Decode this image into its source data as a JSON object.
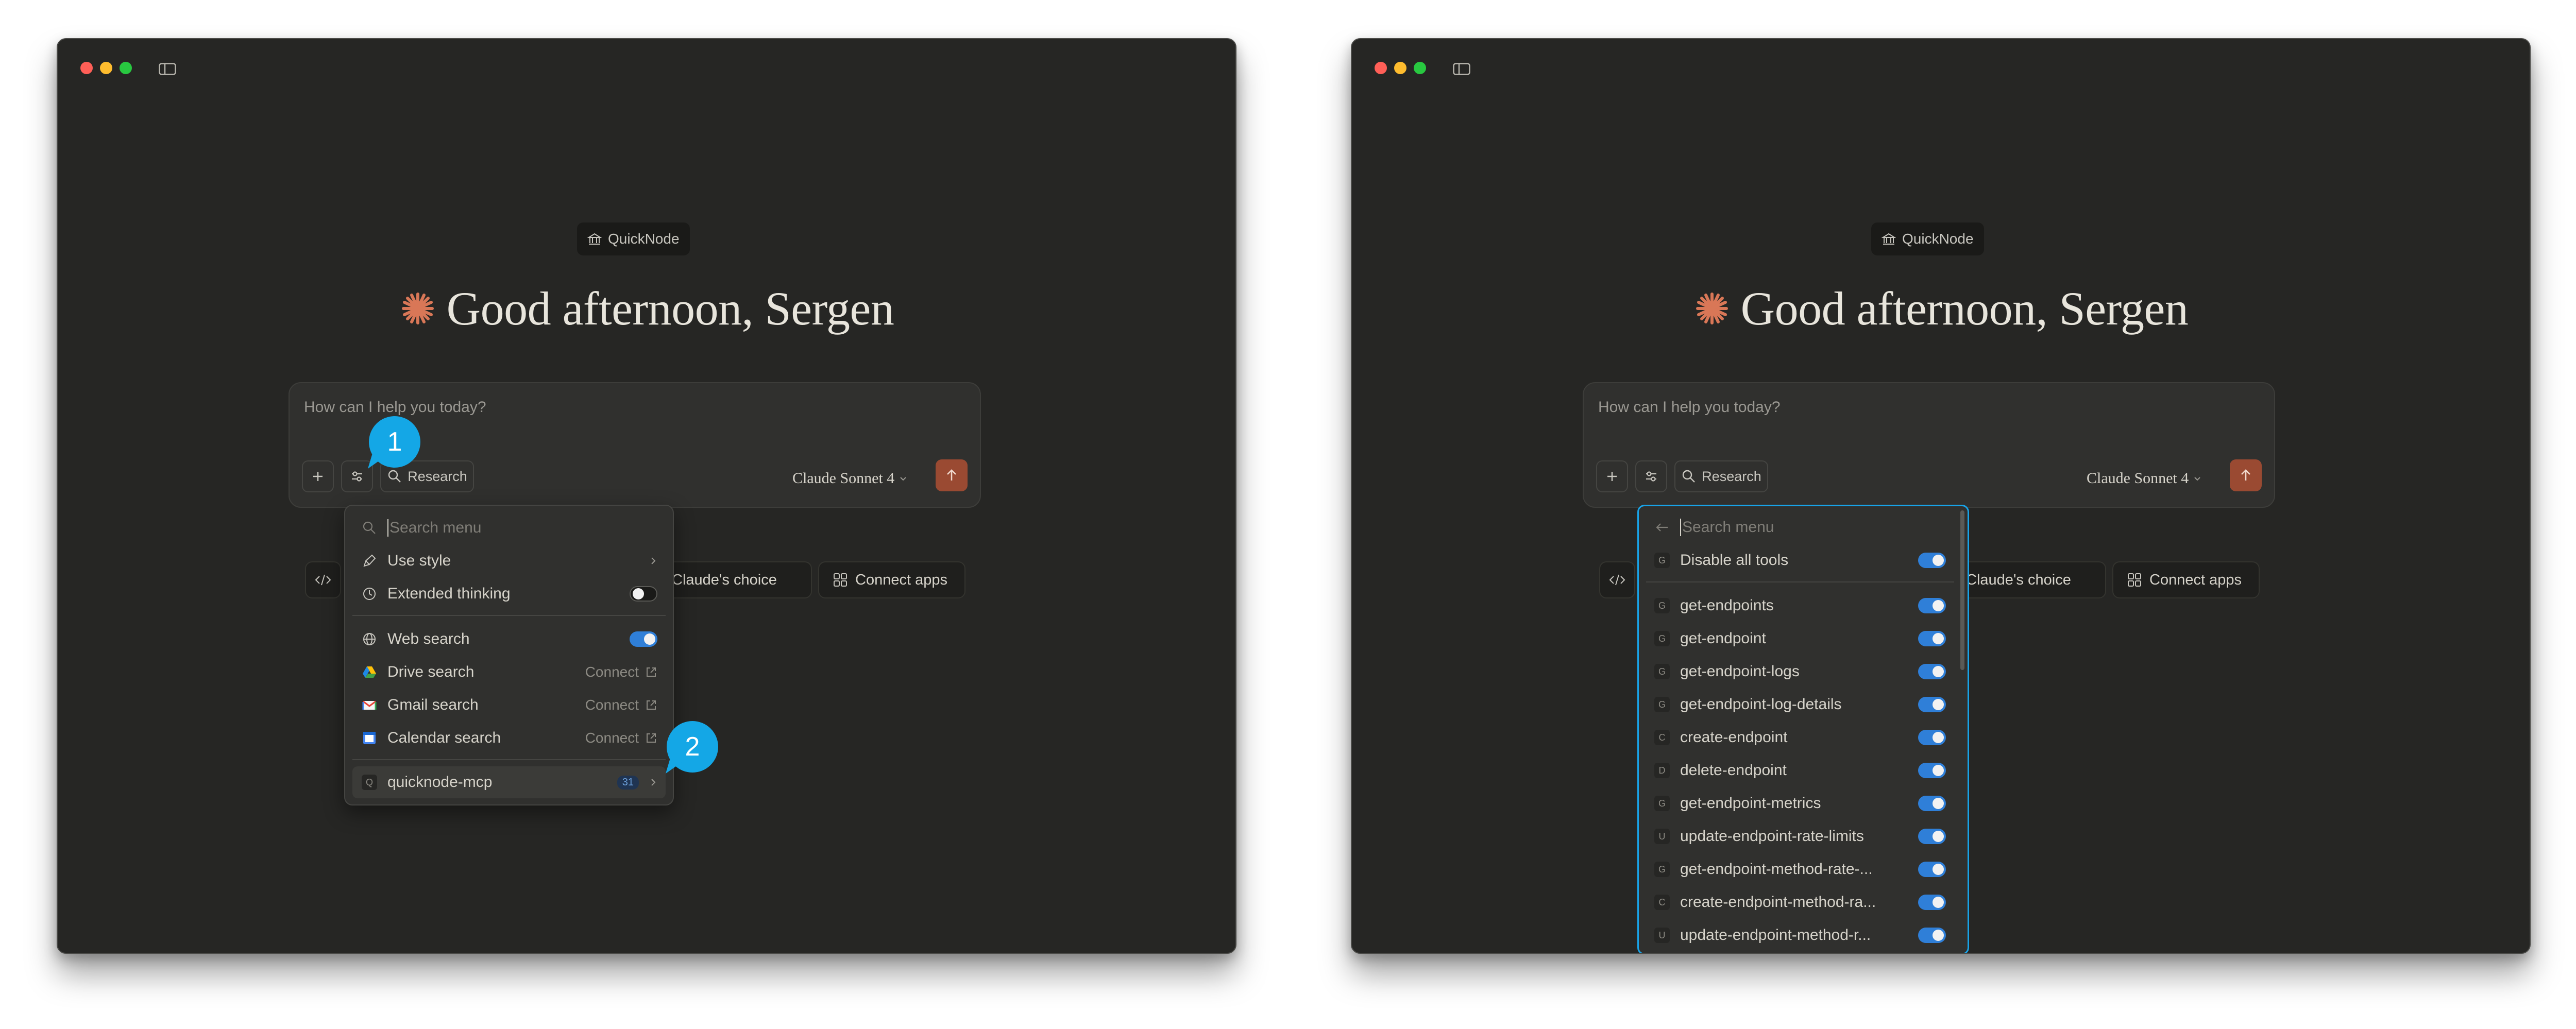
{
  "workspace_label": "QuickNode",
  "greeting": "Good afternoon, Sergen",
  "composer": {
    "placeholder": "How can I help you today?",
    "research_label": "Research",
    "model_label": "Claude Sonnet 4"
  },
  "suggestions": {
    "claudes_choice": "Claude's choice",
    "connect_apps": "Connect apps"
  },
  "callouts": [
    "1",
    "2"
  ],
  "tools_menu": {
    "search_placeholder": "Search menu",
    "use_style": "Use style",
    "extended_thinking": {
      "label": "Extended thinking",
      "enabled": false
    },
    "web_search": {
      "label": "Web search",
      "enabled": true
    },
    "connectors": [
      {
        "label": "Drive search",
        "action": "Connect",
        "icon": "google-drive-icon"
      },
      {
        "label": "Gmail search",
        "action": "Connect",
        "icon": "gmail-icon"
      },
      {
        "label": "Calendar search",
        "action": "Connect",
        "icon": "google-calendar-icon"
      }
    ],
    "mcp_server": {
      "letter": "Q",
      "label": "quicknode-mcp",
      "count": "31"
    }
  },
  "mcp_submenu": {
    "search_placeholder": "Search menu",
    "disable_all": {
      "letter": "G",
      "label": "Disable all tools",
      "enabled": true
    },
    "tools": [
      {
        "letter": "G",
        "name": "get-endpoints",
        "enabled": true
      },
      {
        "letter": "G",
        "name": "get-endpoint",
        "enabled": true
      },
      {
        "letter": "G",
        "name": "get-endpoint-logs",
        "enabled": true
      },
      {
        "letter": "G",
        "name": "get-endpoint-log-details",
        "enabled": true
      },
      {
        "letter": "C",
        "name": "create-endpoint",
        "enabled": true
      },
      {
        "letter": "D",
        "name": "delete-endpoint",
        "enabled": true
      },
      {
        "letter": "G",
        "name": "get-endpoint-metrics",
        "enabled": true
      },
      {
        "letter": "U",
        "name": "update-endpoint-rate-limits",
        "enabled": true
      },
      {
        "letter": "G",
        "name": "get-endpoint-method-rate-...",
        "enabled": true
      },
      {
        "letter": "C",
        "name": "create-endpoint-method-ra...",
        "enabled": true
      },
      {
        "letter": "U",
        "name": "update-endpoint-method-r...",
        "enabled": true
      }
    ]
  },
  "colors": {
    "window_bg": "#262624",
    "accent_send": "#9a4a32",
    "toggle_on": "#2f7fd8",
    "callout": "#14a7e6",
    "claude_star": "#d97757"
  }
}
